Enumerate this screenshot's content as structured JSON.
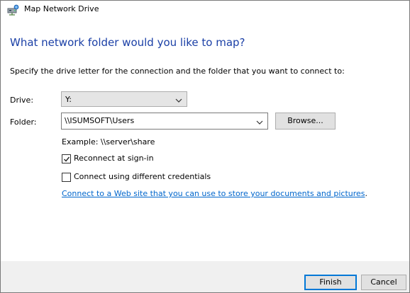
{
  "window": {
    "title": "Map Network Drive"
  },
  "main": {
    "heading": "What network folder would you like to map?",
    "instruction": "Specify the drive letter for the connection and the folder that you want to connect to:",
    "drive_label": "Drive:",
    "drive_value": "Y:",
    "folder_label": "Folder:",
    "folder_value": "\\\\ISUMSOFT\\Users",
    "browse_label": "Browse...",
    "example_text": "Example: \\\\server\\share",
    "reconnect": {
      "label": "Reconnect at sign-in",
      "checked": true
    },
    "different_credentials": {
      "label": "Connect using different credentials",
      "checked": false
    },
    "link_text": "Connect to a Web site that you can use to store your documents and pictures",
    "link_suffix": "."
  },
  "footer": {
    "finish_label": "Finish",
    "cancel_label": "Cancel"
  },
  "colors": {
    "heading": "#1a3fa6",
    "link": "#0066cc",
    "focus": "#0078d7"
  },
  "icons": {
    "title": "network-drive-icon",
    "dropdown": "chevron-down-icon",
    "check": "checkmark-icon"
  }
}
